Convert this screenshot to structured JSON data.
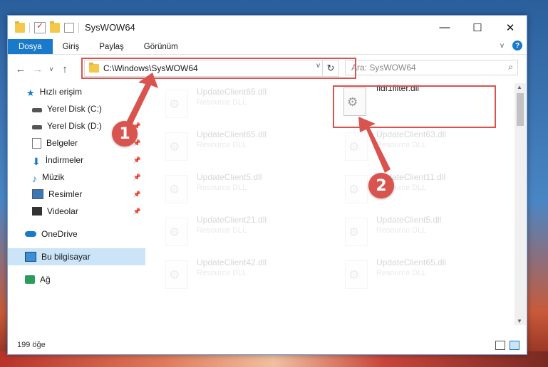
{
  "window": {
    "title": "SysWOW64",
    "controls": {
      "minimize": "—",
      "maximize": "☐",
      "close": "✕"
    }
  },
  "ribbon": {
    "tabs": [
      "Dosya",
      "Giriş",
      "Paylaş",
      "Görünüm"
    ],
    "expand_icon": "v",
    "help_icon": "?"
  },
  "navigation": {
    "back": "←",
    "forward": "→",
    "recent": "v",
    "up": "↑",
    "address": "C:\\Windows\\SysWOW64",
    "address_dropdown": "v",
    "refresh": "↻",
    "search_placeholder": "Ara: SysWOW64",
    "search_icon": "⌕"
  },
  "sidebar": {
    "items": [
      {
        "label": "Hızlı erişim",
        "icon": "star-icon"
      },
      {
        "label": "Yerel Disk (C:)",
        "icon": "disk-icon"
      },
      {
        "label": "Yerel Disk (D:)",
        "icon": "disk-icon"
      },
      {
        "label": "Belgeler",
        "icon": "document-icon"
      },
      {
        "label": "İndirmeler",
        "icon": "download-icon"
      },
      {
        "label": "Müzik",
        "icon": "music-icon"
      },
      {
        "label": "Resimler",
        "icon": "picture-icon"
      },
      {
        "label": "Videolar",
        "icon": "video-icon"
      },
      {
        "label": "OneDrive",
        "icon": "cloud-icon"
      },
      {
        "label": "Bu bilgisayar",
        "icon": "computer-icon"
      },
      {
        "label": "Ağ",
        "icon": "network-icon"
      }
    ]
  },
  "files": {
    "left": [
      {
        "name": "UpdateClient65.dll",
        "type": "Resource DLL"
      },
      {
        "name": "UpdateClient65.dll",
        "type": "Resource DLL"
      },
      {
        "name": "UpdateClient5.dll",
        "type": "Resource DLL"
      },
      {
        "name": "UpdateClient21.dll",
        "type": "Resource DLL"
      },
      {
        "name": "UpdateClient42.dll",
        "type": "Resource DLL"
      }
    ],
    "right": [
      {
        "name": "fidf1filter.dll",
        "type": ""
      },
      {
        "name": "UpdateClient63.dll",
        "type": "Resource DLL"
      },
      {
        "name": "UpdateClient11.dll",
        "type": "Resource DLL"
      },
      {
        "name": "UpdateClient5.dll",
        "type": "Resource DLL"
      },
      {
        "name": "UpdateClient65.dll",
        "type": "Resource DLL"
      }
    ]
  },
  "status": {
    "item_count": "199 öğe"
  },
  "annotations": {
    "step1": "1",
    "step2": "2"
  },
  "colors": {
    "accent": "#1979ca",
    "annotation": "#d9534f",
    "selected": "#cce4f7"
  }
}
